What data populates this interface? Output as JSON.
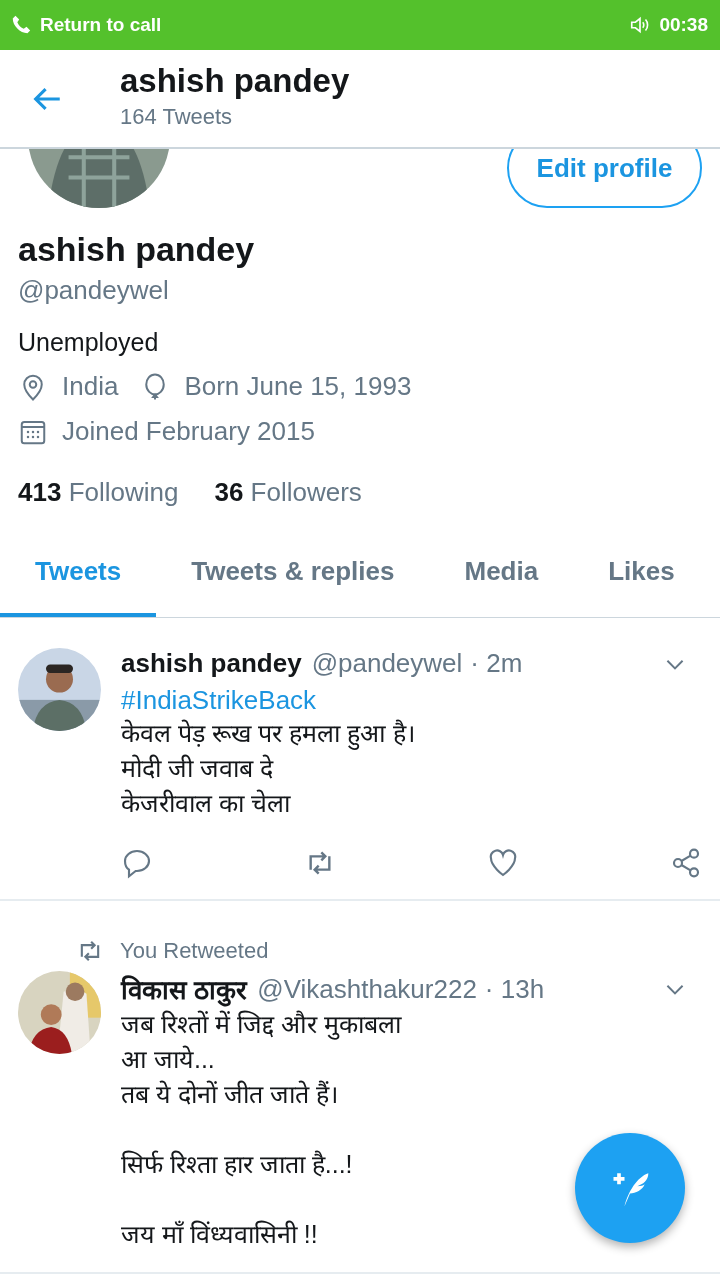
{
  "call_banner": {
    "label": "Return to call",
    "timer": "00:38"
  },
  "header": {
    "title": "ashish pandey",
    "subtitle": "164 Tweets"
  },
  "profile": {
    "edit_button": "Edit profile",
    "name": "ashish pandey",
    "handle": "@pandeywel",
    "bio": "Unemployed",
    "location": "India",
    "birthday": "Born June 15, 1993",
    "joined": "Joined February 2015",
    "stats": [
      {
        "count": "413",
        "label": "Following"
      },
      {
        "count": "36",
        "label": "Followers"
      }
    ]
  },
  "tabs": [
    {
      "label": "Tweets",
      "selected": true
    },
    {
      "label": "Tweets & replies",
      "selected": false
    },
    {
      "label": "Media",
      "selected": false
    },
    {
      "label": "Likes",
      "selected": false
    }
  ],
  "tweets": [
    {
      "name": "ashish pandey",
      "handle": "@pandeywel",
      "time": "· 2m",
      "hashtag": "#IndiaStrikeBack",
      "text": "केवल पेड़ रूख पर हमला हुआ है।\nमोदी जी जवाब दे\nकेजरीवाल का चेला",
      "actions": true
    },
    {
      "retweeted_label": "You Retweeted",
      "name": "विकास ठाकुर",
      "handle": "@Vikashthakur222",
      "time": "· 13h",
      "text": "जब रिश्तों में जिद्द और मुकाबला\nआ जाये...\nतब ये दोनों जीत जाते हैं।\n\nसिर्फ रिश्ता हार जाता है...!\n\nजय माँ विंध्यवासिनी !!"
    }
  ]
}
